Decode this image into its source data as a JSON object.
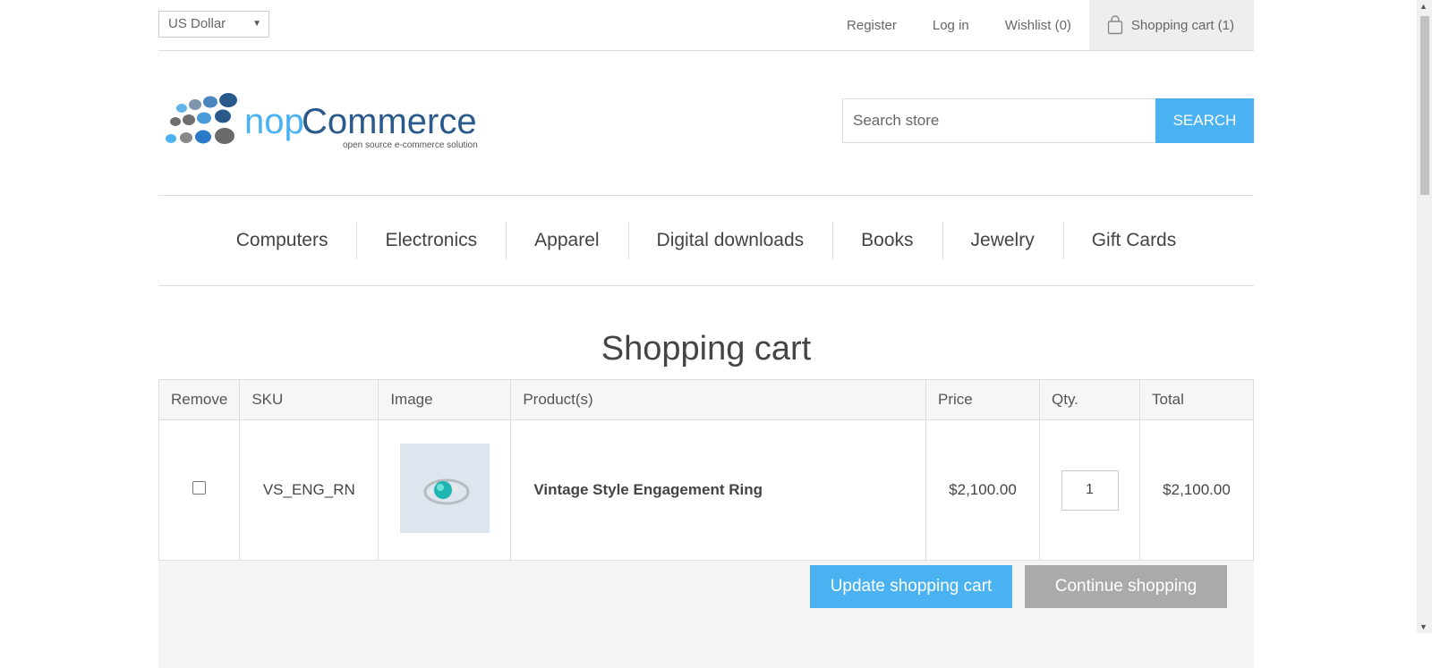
{
  "header": {
    "currency": "US Dollar",
    "links": {
      "register": "Register",
      "login": "Log in",
      "wishlist": "Wishlist (0)",
      "cart": "Shopping cart (1)"
    }
  },
  "search": {
    "placeholder": "Search store",
    "button": "SEARCH"
  },
  "menu": [
    "Computers",
    "Electronics",
    "Apparel",
    "Digital downloads",
    "Books",
    "Jewelry",
    "Gift Cards"
  ],
  "page": {
    "title": "Shopping cart"
  },
  "cart": {
    "headers": {
      "remove": "Remove",
      "sku": "SKU",
      "image": "Image",
      "product": "Product(s)",
      "price": "Price",
      "qty": "Qty.",
      "total": "Total"
    },
    "items": [
      {
        "sku": "VS_ENG_RN",
        "name": "Vintage Style Engagement Ring",
        "price": "$2,100.00",
        "qty": "1",
        "total": "$2,100.00"
      }
    ],
    "buttons": {
      "update": "Update shopping cart",
      "continue": "Continue shopping"
    }
  },
  "colors": {
    "accent": "#4ab2f1",
    "secondary_button": "#aaaaaa"
  },
  "icons": [
    "shopping-bag-icon",
    "nopcommerce-logo",
    "chevron-down-icon"
  ]
}
